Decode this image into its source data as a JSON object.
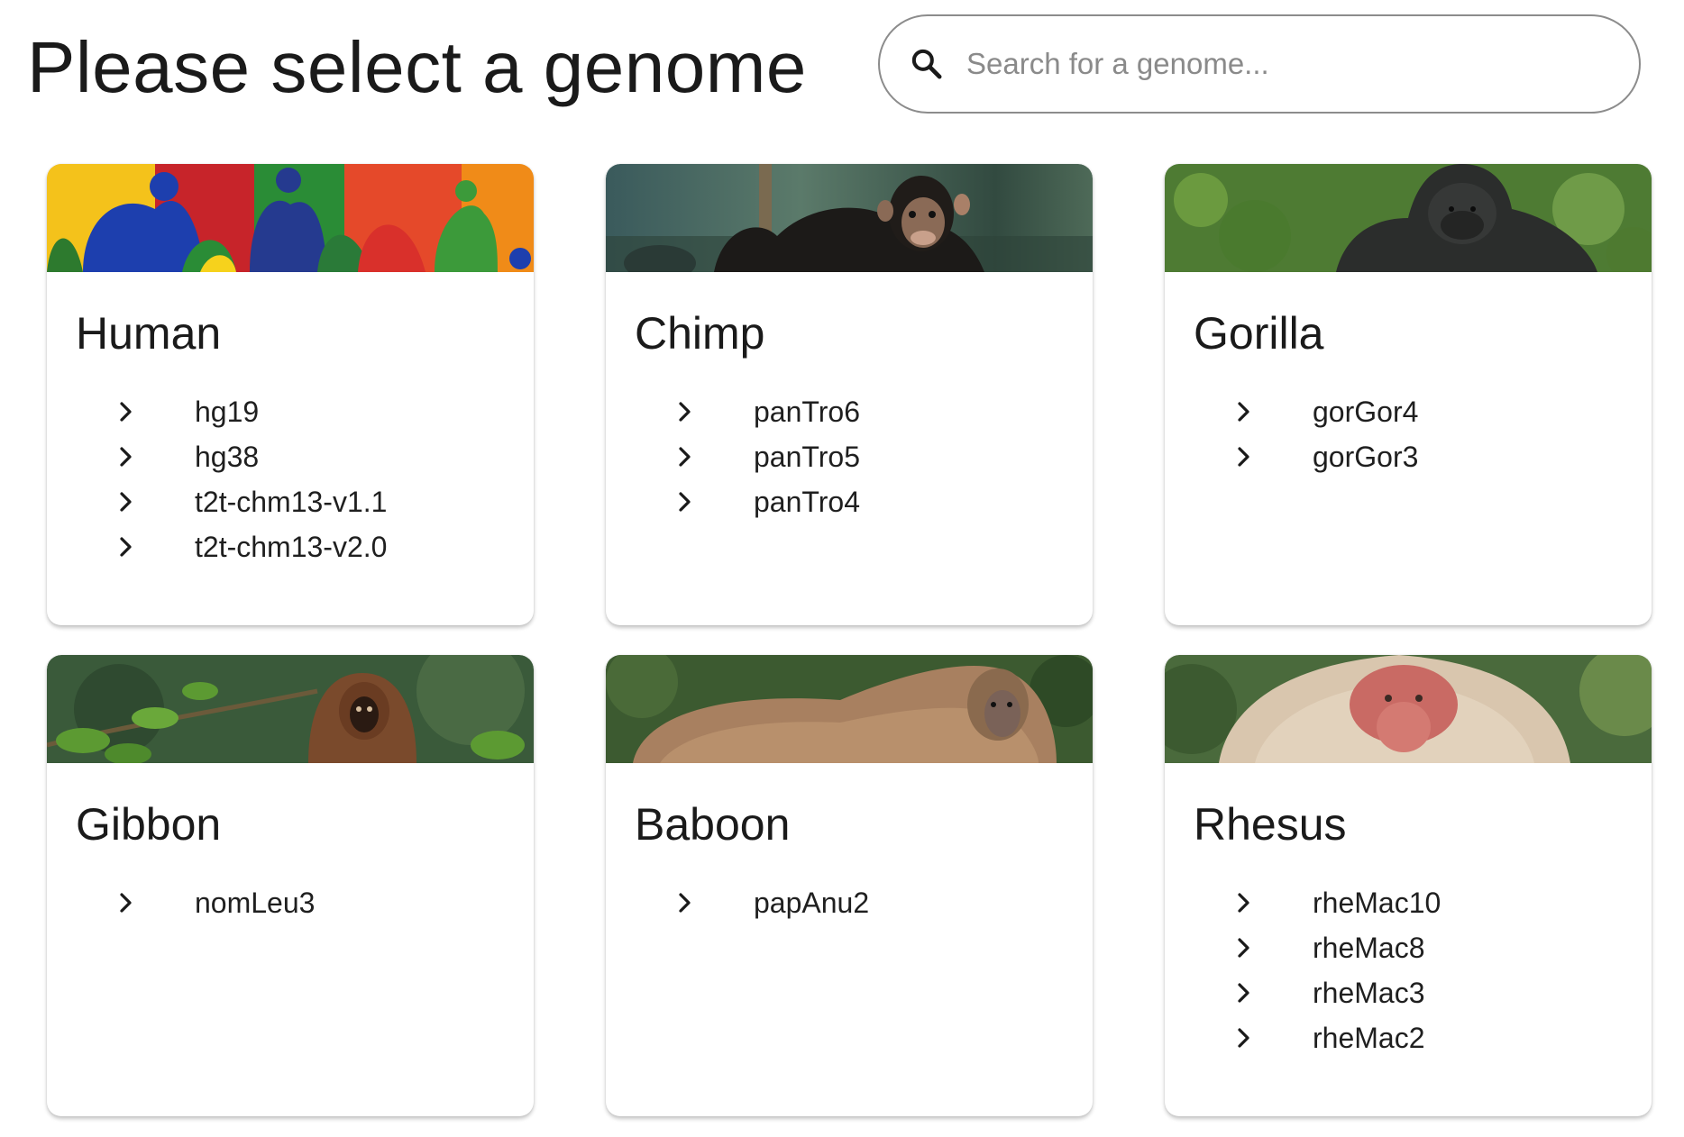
{
  "header": {
    "title": "Please select a genome"
  },
  "search": {
    "placeholder": "Search for a genome...",
    "value": ""
  },
  "species": [
    {
      "name": "Human",
      "banner": "crowd-painting",
      "assemblies": [
        "hg19",
        "hg38",
        "t2t-chm13-v1.1",
        "t2t-chm13-v2.0"
      ]
    },
    {
      "name": "Chimp",
      "banner": "chimpanzee-photo",
      "assemblies": [
        "panTro6",
        "panTro5",
        "panTro4"
      ]
    },
    {
      "name": "Gorilla",
      "banner": "gorilla-photo",
      "assemblies": [
        "gorGor4",
        "gorGor3"
      ]
    },
    {
      "name": "Gibbon",
      "banner": "gibbon-photo",
      "assemblies": [
        "nomLeu3"
      ]
    },
    {
      "name": "Baboon",
      "banner": "baboon-photo",
      "assemblies": [
        "papAnu2"
      ]
    },
    {
      "name": "Rhesus",
      "banner": "rhesus-photo",
      "assemblies": [
        "rheMac10",
        "rheMac8",
        "rheMac3",
        "rheMac2"
      ]
    }
  ],
  "icons": {
    "search": "search-icon",
    "item": "chevron-right-icon"
  },
  "colors": {
    "text": "#1f1f1f",
    "border": "#8c8c8c",
    "placeholder": "#8a8a8a"
  }
}
